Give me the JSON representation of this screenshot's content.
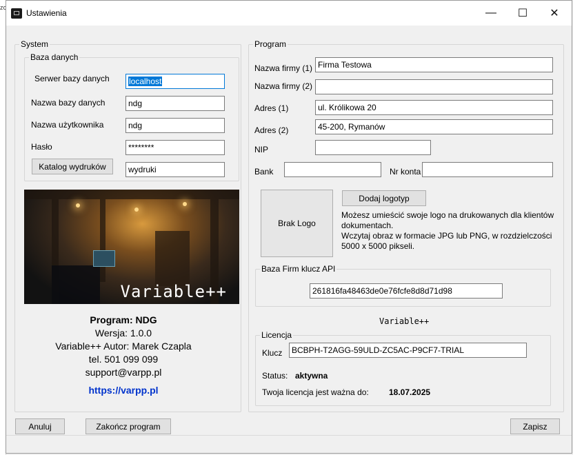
{
  "window": {
    "title": "Ustawienia",
    "minimize_glyph": "—",
    "maximize_glyph": "☐",
    "close_glyph": "✕"
  },
  "behind_fragment": "zc",
  "system": {
    "group_label": "System",
    "database": {
      "group_label": "Baza danych",
      "server_label": "Serwer bazy danych",
      "server_value": "localhost",
      "dbname_label": "Nazwa bazy danych",
      "dbname_value": "ndg",
      "user_label": "Nazwa użytkownika",
      "user_value": "ndg",
      "password_label": "Hasło",
      "password_value": "********",
      "prints_button": "Katalog wydruków",
      "prints_value": "wydruki"
    },
    "banner_brand": "Variable++",
    "about": {
      "program": "Program: NDG",
      "version": "Wersja: 1.0.0",
      "author": "Variable++ Autor: Marek Czapla",
      "phone": "tel. 501 099 099",
      "email": "support@varpp.pl",
      "website": "https://varpp.pl"
    }
  },
  "program": {
    "group_label": "Program",
    "company1_label": "Nazwa firmy (1)",
    "company1_value": "Firma Testowa",
    "company2_label": "Nazwa firmy (2)",
    "company2_value": "",
    "address1_label": "Adres (1)",
    "address1_value": "ul. Królikowa 20",
    "address2_label": "Adres (2)",
    "address2_value": "45-200, Rymanów",
    "nip_label": "NIP",
    "nip_value": "",
    "bank_label": "Bank",
    "bank_value": "",
    "account_label": "Nr konta",
    "account_value": "",
    "logo_placeholder": "Brak Logo",
    "add_logo_button": "Dodaj logotyp",
    "logo_description_1": "Możesz umieścić swoje logo na drukowanych dla klientów dokumentach.",
    "logo_description_2": "Wczytaj obraz w formacie JPG lub PNG, w rozdzielczości 5000 x 5000 pikseli.",
    "api": {
      "group_label": "Baza Firm klucz API",
      "key_value": "261816fa48463de0e76fcfe8d8d71d98"
    },
    "brand_text": "Variable++",
    "license": {
      "group_label": "Licencja",
      "key_label": "Klucz",
      "key_value": "BCBPH-T2AGG-59ULD-ZC5AC-P9CF7-TRIAL",
      "status_label": "Status:",
      "status_value": "aktywna",
      "valid_label": "Twoja licencja jest ważna do:",
      "valid_value": "18.07.2025"
    }
  },
  "footer": {
    "cancel_button": "Anuluj",
    "exit_button": "Zakończ program",
    "save_button": "Zapisz"
  }
}
